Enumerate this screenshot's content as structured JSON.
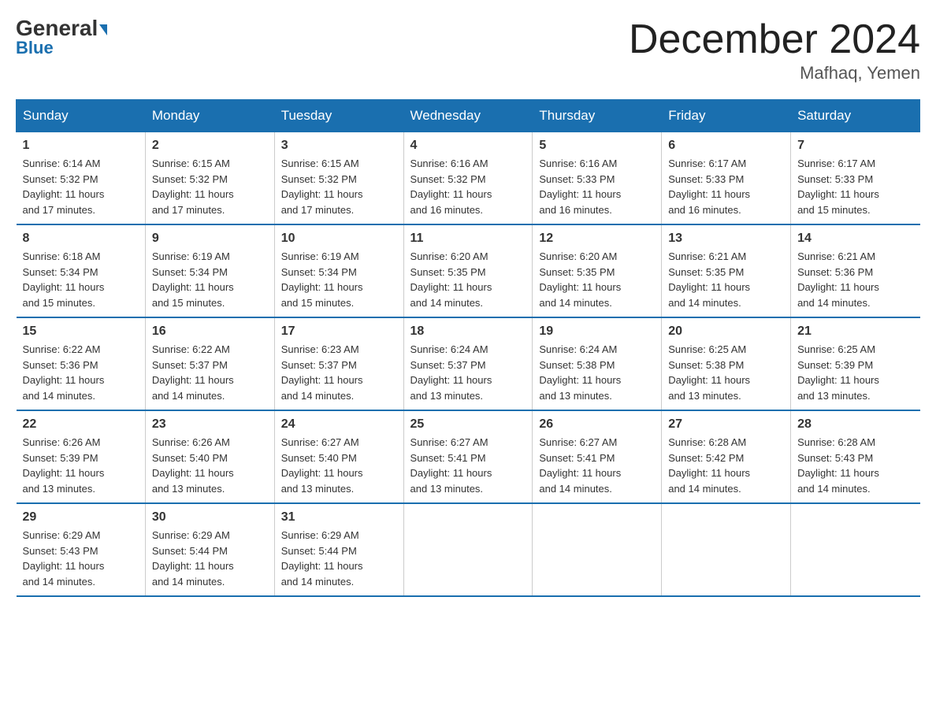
{
  "logo": {
    "general": "General",
    "blue": "Blue"
  },
  "title": {
    "month": "December 2024",
    "location": "Mafhaq, Yemen"
  },
  "headers": [
    "Sunday",
    "Monday",
    "Tuesday",
    "Wednesday",
    "Thursday",
    "Friday",
    "Saturday"
  ],
  "weeks": [
    [
      {
        "day": "1",
        "info": "Sunrise: 6:14 AM\nSunset: 5:32 PM\nDaylight: 11 hours\nand 17 minutes."
      },
      {
        "day": "2",
        "info": "Sunrise: 6:15 AM\nSunset: 5:32 PM\nDaylight: 11 hours\nand 17 minutes."
      },
      {
        "day": "3",
        "info": "Sunrise: 6:15 AM\nSunset: 5:32 PM\nDaylight: 11 hours\nand 17 minutes."
      },
      {
        "day": "4",
        "info": "Sunrise: 6:16 AM\nSunset: 5:32 PM\nDaylight: 11 hours\nand 16 minutes."
      },
      {
        "day": "5",
        "info": "Sunrise: 6:16 AM\nSunset: 5:33 PM\nDaylight: 11 hours\nand 16 minutes."
      },
      {
        "day": "6",
        "info": "Sunrise: 6:17 AM\nSunset: 5:33 PM\nDaylight: 11 hours\nand 16 minutes."
      },
      {
        "day": "7",
        "info": "Sunrise: 6:17 AM\nSunset: 5:33 PM\nDaylight: 11 hours\nand 15 minutes."
      }
    ],
    [
      {
        "day": "8",
        "info": "Sunrise: 6:18 AM\nSunset: 5:34 PM\nDaylight: 11 hours\nand 15 minutes."
      },
      {
        "day": "9",
        "info": "Sunrise: 6:19 AM\nSunset: 5:34 PM\nDaylight: 11 hours\nand 15 minutes."
      },
      {
        "day": "10",
        "info": "Sunrise: 6:19 AM\nSunset: 5:34 PM\nDaylight: 11 hours\nand 15 minutes."
      },
      {
        "day": "11",
        "info": "Sunrise: 6:20 AM\nSunset: 5:35 PM\nDaylight: 11 hours\nand 14 minutes."
      },
      {
        "day": "12",
        "info": "Sunrise: 6:20 AM\nSunset: 5:35 PM\nDaylight: 11 hours\nand 14 minutes."
      },
      {
        "day": "13",
        "info": "Sunrise: 6:21 AM\nSunset: 5:35 PM\nDaylight: 11 hours\nand 14 minutes."
      },
      {
        "day": "14",
        "info": "Sunrise: 6:21 AM\nSunset: 5:36 PM\nDaylight: 11 hours\nand 14 minutes."
      }
    ],
    [
      {
        "day": "15",
        "info": "Sunrise: 6:22 AM\nSunset: 5:36 PM\nDaylight: 11 hours\nand 14 minutes."
      },
      {
        "day": "16",
        "info": "Sunrise: 6:22 AM\nSunset: 5:37 PM\nDaylight: 11 hours\nand 14 minutes."
      },
      {
        "day": "17",
        "info": "Sunrise: 6:23 AM\nSunset: 5:37 PM\nDaylight: 11 hours\nand 14 minutes."
      },
      {
        "day": "18",
        "info": "Sunrise: 6:24 AM\nSunset: 5:37 PM\nDaylight: 11 hours\nand 13 minutes."
      },
      {
        "day": "19",
        "info": "Sunrise: 6:24 AM\nSunset: 5:38 PM\nDaylight: 11 hours\nand 13 minutes."
      },
      {
        "day": "20",
        "info": "Sunrise: 6:25 AM\nSunset: 5:38 PM\nDaylight: 11 hours\nand 13 minutes."
      },
      {
        "day": "21",
        "info": "Sunrise: 6:25 AM\nSunset: 5:39 PM\nDaylight: 11 hours\nand 13 minutes."
      }
    ],
    [
      {
        "day": "22",
        "info": "Sunrise: 6:26 AM\nSunset: 5:39 PM\nDaylight: 11 hours\nand 13 minutes."
      },
      {
        "day": "23",
        "info": "Sunrise: 6:26 AM\nSunset: 5:40 PM\nDaylight: 11 hours\nand 13 minutes."
      },
      {
        "day": "24",
        "info": "Sunrise: 6:27 AM\nSunset: 5:40 PM\nDaylight: 11 hours\nand 13 minutes."
      },
      {
        "day": "25",
        "info": "Sunrise: 6:27 AM\nSunset: 5:41 PM\nDaylight: 11 hours\nand 13 minutes."
      },
      {
        "day": "26",
        "info": "Sunrise: 6:27 AM\nSunset: 5:41 PM\nDaylight: 11 hours\nand 14 minutes."
      },
      {
        "day": "27",
        "info": "Sunrise: 6:28 AM\nSunset: 5:42 PM\nDaylight: 11 hours\nand 14 minutes."
      },
      {
        "day": "28",
        "info": "Sunrise: 6:28 AM\nSunset: 5:43 PM\nDaylight: 11 hours\nand 14 minutes."
      }
    ],
    [
      {
        "day": "29",
        "info": "Sunrise: 6:29 AM\nSunset: 5:43 PM\nDaylight: 11 hours\nand 14 minutes."
      },
      {
        "day": "30",
        "info": "Sunrise: 6:29 AM\nSunset: 5:44 PM\nDaylight: 11 hours\nand 14 minutes."
      },
      {
        "day": "31",
        "info": "Sunrise: 6:29 AM\nSunset: 5:44 PM\nDaylight: 11 hours\nand 14 minutes."
      },
      {
        "day": "",
        "info": ""
      },
      {
        "day": "",
        "info": ""
      },
      {
        "day": "",
        "info": ""
      },
      {
        "day": "",
        "info": ""
      }
    ]
  ]
}
